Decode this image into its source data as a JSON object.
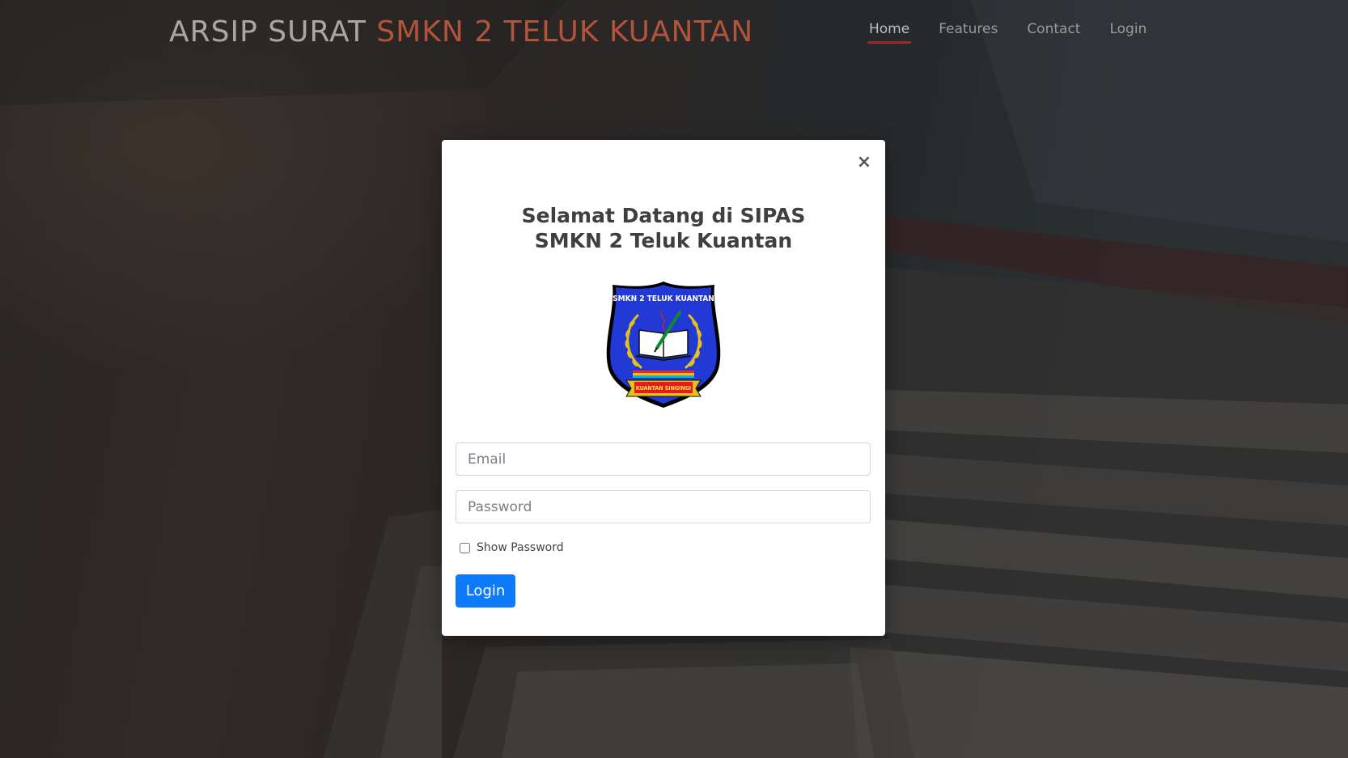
{
  "navbar": {
    "brand_part1": "ARSIP SURAT ",
    "brand_part2": "SMKN 2 TELUK KUANTAN",
    "links": [
      {
        "label": "Home",
        "active": true
      },
      {
        "label": "Features",
        "active": false
      },
      {
        "label": "Contact",
        "active": false
      },
      {
        "label": "Login",
        "active": false
      }
    ]
  },
  "modal": {
    "close_symbol": "×",
    "title_line1": "Selamat Datang di SIPAS",
    "title_line2": "SMKN 2 Teluk Kuantan",
    "logo": {
      "top_text": "SMKN 2 TELUK KUANTAN",
      "bottom_text": "KUANTAN SINGINGI"
    },
    "email": {
      "placeholder": "Email",
      "value": ""
    },
    "password": {
      "placeholder": "Password",
      "value": ""
    },
    "show_password_label": "Show Password",
    "show_password_checked": false,
    "login_button": "Login"
  },
  "colors": {
    "brand_gray": "#a7a7a7",
    "brand_accent": "#b2533c",
    "nav_active_underline": "#9b2b2b",
    "primary_button": "#0d7bf7",
    "logo_blue": "#2239d6",
    "logo_gold": "#e4c21a"
  }
}
